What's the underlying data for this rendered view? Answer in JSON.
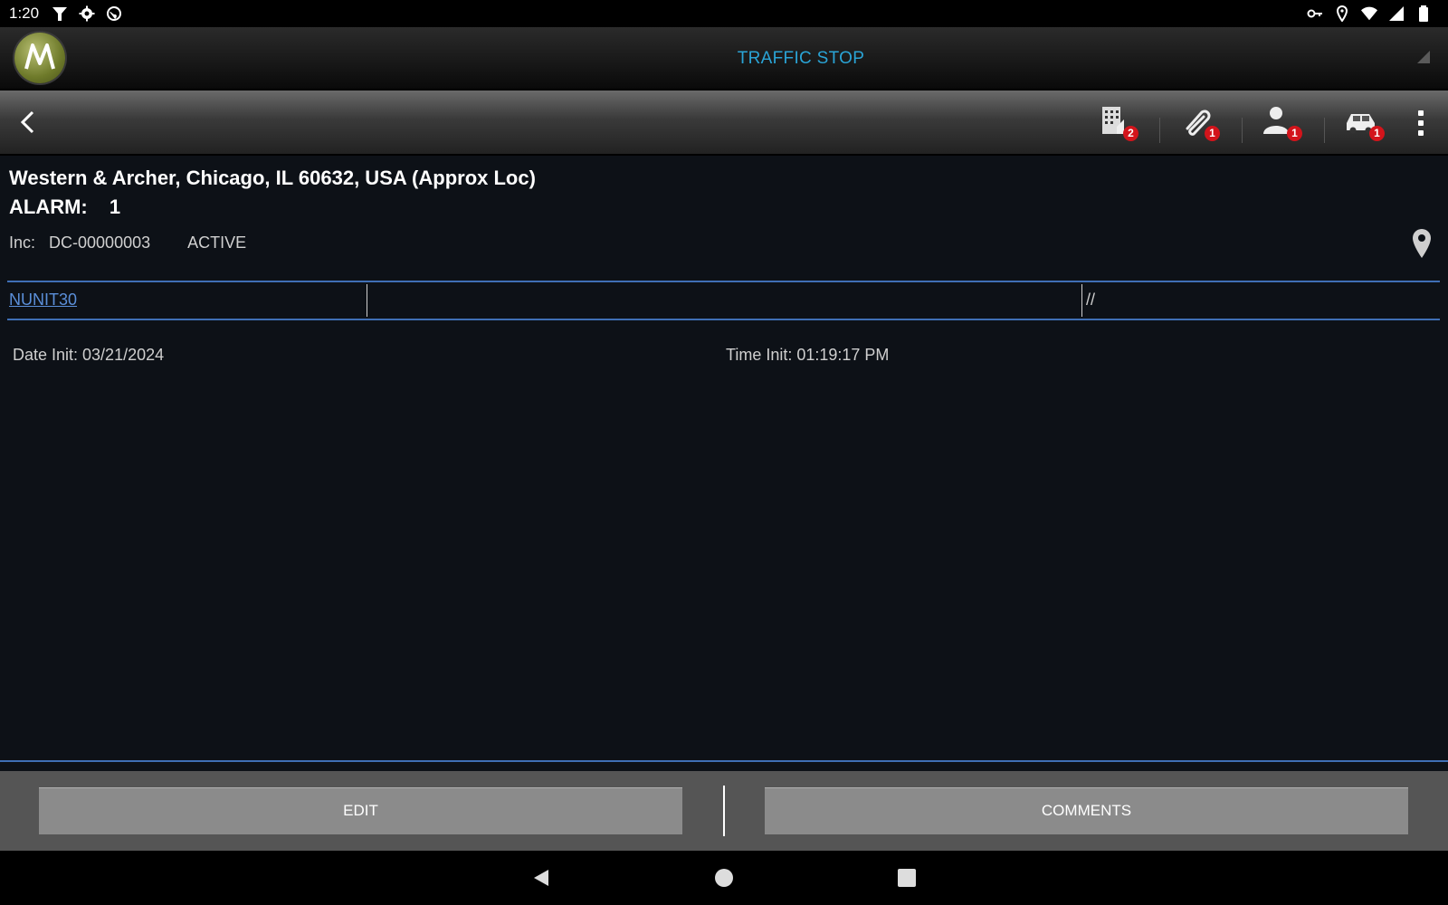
{
  "status_bar": {
    "time": "1:20",
    "left_icons": [
      "signal-tower-icon",
      "settings-icon",
      "globe-icon"
    ],
    "right_icons": [
      "vpn-key-icon",
      "location-icon",
      "wifi-icon",
      "cell-signal-icon",
      "battery-icon"
    ]
  },
  "app_header": {
    "logo": "motorola-logo",
    "title": "TRAFFIC STOP"
  },
  "toolbar": {
    "items": [
      {
        "icon": "building-icon",
        "badge": "2"
      },
      {
        "icon": "paperclip-icon",
        "badge": "1"
      },
      {
        "icon": "person-icon",
        "badge": "1"
      },
      {
        "icon": "car-icon",
        "badge": "1"
      }
    ]
  },
  "incident": {
    "address": "Western & Archer, Chicago, IL 60632, USA (Approx Loc)",
    "alarm_label": "ALARM:",
    "alarm_value": "1",
    "inc_label": "Inc:",
    "inc_number": "DC-00000003",
    "status": "ACTIVE"
  },
  "unit_row": {
    "unit": "NUNIT30",
    "middle": "",
    "right": "//"
  },
  "dates": {
    "date_init": "Date Init: 03/21/2024",
    "time_init": "Time Init: 01:19:17 PM"
  },
  "actions": {
    "edit_label": "EDIT",
    "comments_label": "COMMENTS"
  },
  "colors": {
    "accent": "#2aa4d6",
    "divider": "#3f6fb5",
    "badge": "#d3141b",
    "link": "#5b8fd9"
  }
}
